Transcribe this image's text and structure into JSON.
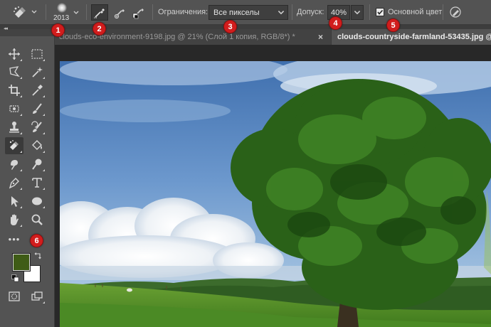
{
  "options_bar": {
    "brush_size": "2013",
    "limits_label": "Ограничения:",
    "limits_value": "Все пикселы",
    "tolerance_label": "Допуск:",
    "tolerance_value": "40%",
    "protect_foreground_label": "Основной цвет",
    "protect_foreground_checked": true
  },
  "badges": [
    "1",
    "2",
    "3",
    "4",
    "5",
    "6"
  ],
  "tabs": [
    {
      "title": "clouds-eco-environment-9198.jpg @ 21% (Слой 1 копия, RGB/8*) *",
      "close": "×",
      "active": false
    },
    {
      "title": "clouds-countryside-farmland-53435.jpg @",
      "active": true
    }
  ],
  "toolbox": {
    "more_tools": "•••",
    "foreground_color": "#3f5c16",
    "background_color": "#ffffff"
  },
  "colors": {
    "ui_bg": "#535353",
    "badge": "#d11d1d",
    "sky": "#5a86c0",
    "foliage": "#2f6a1a"
  }
}
